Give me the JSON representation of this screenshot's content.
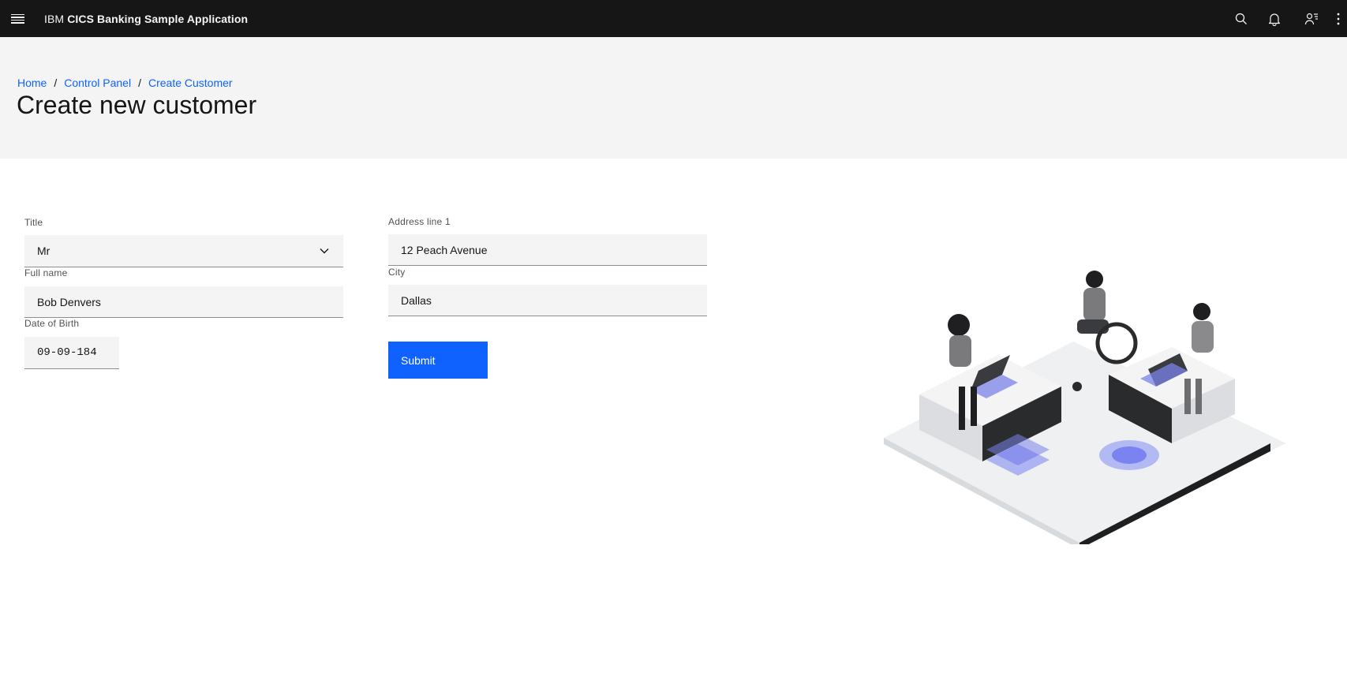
{
  "header": {
    "brand_prefix": "IBM",
    "brand_name": "CICS Banking Sample Application",
    "icons": [
      "menu-icon",
      "search-icon",
      "notification-icon",
      "user-icon",
      "overflow-menu-icon"
    ]
  },
  "breadcrumb": {
    "items": [
      "Home",
      "Control Panel",
      "Create Customer"
    ],
    "separator": "/"
  },
  "page": {
    "title": "Create new customer"
  },
  "form": {
    "title": {
      "label": "Title",
      "value": "Mr"
    },
    "full_name": {
      "label": "Full name",
      "value": "Bob Denvers"
    },
    "dob": {
      "label": "Date of Birth",
      "value": "09-09-184"
    },
    "address1": {
      "label": "Address line 1",
      "value": "12 Peach Avenue"
    },
    "city": {
      "label": "City",
      "value": "Dallas"
    },
    "submit_label": "Submit"
  },
  "colors": {
    "header_bg": "#161616",
    "banner_bg": "#f4f4f4",
    "link": "#0f62fe",
    "primary_button": "#0f62fe",
    "field_bg": "#f4f4f4"
  }
}
